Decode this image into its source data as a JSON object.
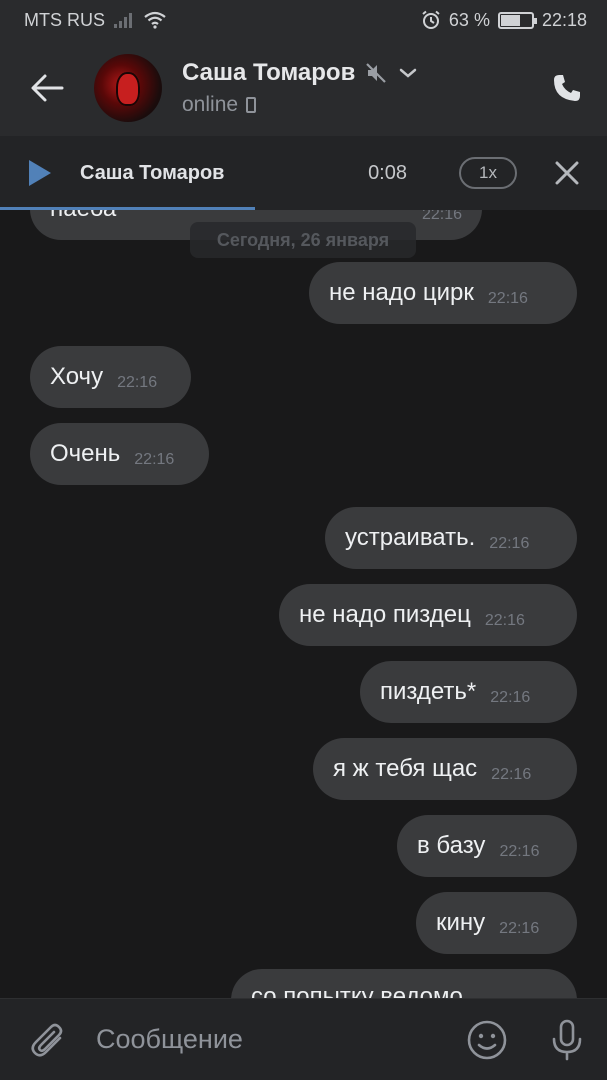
{
  "status_bar": {
    "carrier": "MTS RUS",
    "battery_percent": "63 %",
    "battery_level": 0.63,
    "time": "22:18"
  },
  "header": {
    "peer_name": "Саша Томаров",
    "peer_status": "online"
  },
  "player": {
    "title": "Саша Томаров",
    "time": "0:08",
    "speed": "1x",
    "progress": 0.42
  },
  "date_separator": "Сегодня, 26 января",
  "messages": [
    {
      "text": "наеба",
      "time": "22:16",
      "direction": "in"
    },
    {
      "text": "не надо цирк",
      "time": "22:16",
      "direction": "out"
    },
    {
      "text": "Хочу",
      "time": "22:16",
      "direction": "in"
    },
    {
      "text": "Очень",
      "time": "22:16",
      "direction": "in"
    },
    {
      "text": "устраивать.",
      "time": "22:16",
      "direction": "out"
    },
    {
      "text": "не надо пиздец",
      "time": "22:16",
      "direction": "out"
    },
    {
      "text": "пиздеть*",
      "time": "22:16",
      "direction": "out"
    },
    {
      "text": "я ж тебя щас",
      "time": "22:16",
      "direction": "out"
    },
    {
      "text": "в базу",
      "time": "22:16",
      "direction": "out"
    },
    {
      "text": "кину",
      "time": "22:16",
      "direction": "out"
    },
    {
      "text": "со попытку ведомо",
      "time": "",
      "direction": "out"
    }
  ],
  "composer": {
    "placeholder": "Сообщение"
  },
  "colors": {
    "accent": "#5181b8",
    "bubble": "#3a3b3d",
    "background": "#19191a",
    "bar": "#2a2b2d"
  }
}
